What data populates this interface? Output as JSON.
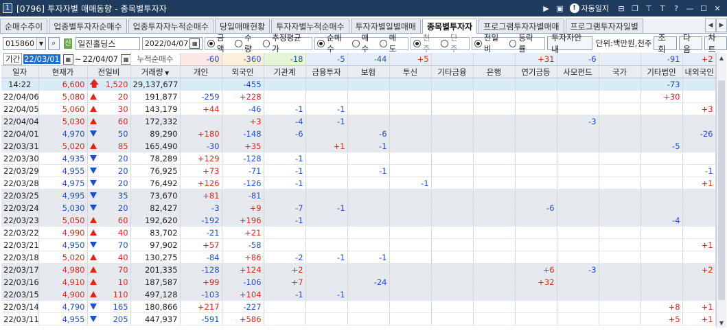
{
  "window": {
    "badge": "1",
    "title": "[0796] 투자자별 매매동향 - 종목별투자자",
    "auto_lock": "자동일지"
  },
  "tabs": [
    {
      "label": "순매수추이",
      "active": false
    },
    {
      "label": "업종별투자자순매수",
      "active": false
    },
    {
      "label": "업종투자자누적순매수",
      "active": false
    },
    {
      "label": "당일매매현황",
      "active": false
    },
    {
      "label": "투자자별누적순매수",
      "active": false
    },
    {
      "label": "투자자별일별매매",
      "active": false
    },
    {
      "label": "종목별투자자",
      "active": true
    },
    {
      "label": "프로그램투자자별매매",
      "active": false
    },
    {
      "label": "프로그램투자자일별",
      "active": false
    }
  ],
  "toolbar": {
    "code": "015860",
    "sin": "신",
    "stock_name": "일진홀딩스",
    "date": "2022/04/07",
    "radio_amount": [
      "금액",
      "수량",
      "추정평균가"
    ],
    "radio_trade": [
      "순매수",
      "매수",
      "매도"
    ],
    "radio_unit": [
      "천주",
      "단주"
    ],
    "radio_compare": [
      "전일비",
      "등락률"
    ],
    "guide_btn": "투자자안내",
    "unit_text": "단위:백만원,천주",
    "search_btn": "조회",
    "next_btn": "다음",
    "chart_btn": "차트"
  },
  "period": {
    "label": "기간",
    "from": "22/03/01",
    "to": "22/04/07",
    "cumulative": "누적순매수"
  },
  "summary": [
    "",
    "",
    "",
    "-60",
    "-360",
    "-18",
    "-5",
    "-44",
    "+5",
    "",
    "",
    "+31",
    "-6",
    "",
    "-91",
    "+2"
  ],
  "columns": [
    "일자",
    "현재가",
    "전일비",
    "거래량",
    "개인",
    "외국인",
    "기관계",
    "금융투자",
    "보험",
    "투신",
    "기타금융",
    "은행",
    "연기금등",
    "사모펀드",
    "국가",
    "기타법인",
    "내외국인"
  ],
  "rows": [
    {
      "date": "14:22",
      "price": "6,600",
      "dir": "upper",
      "chg": "1,520",
      "vol": "29,137,677",
      "v": [
        "",
        "-455",
        "",
        "",
        "",
        "",
        "",
        "",
        "",
        "",
        "",
        "-73",
        ""
      ],
      "now": true
    },
    {
      "date": "22/04/06",
      "price": "5,080",
      "dir": "up",
      "chg": "20",
      "vol": "191,877",
      "v": [
        "-259",
        "+228",
        "",
        "",
        "",
        "",
        "",
        "",
        "",
        "",
        "",
        "+30",
        ""
      ]
    },
    {
      "date": "22/04/05",
      "price": "5,060",
      "dir": "up",
      "chg": "30",
      "vol": "143,179",
      "v": [
        "+44",
        "-46",
        "-1",
        "-1",
        "",
        "",
        "",
        "",
        "",
        "",
        "",
        "",
        "+3"
      ]
    },
    {
      "date": "22/04/04",
      "price": "5,030",
      "dir": "up",
      "chg": "60",
      "vol": "172,332",
      "v": [
        "",
        "+3",
        "-4",
        "-1",
        "",
        "",
        "",
        "",
        "",
        "-3",
        "",
        "",
        ""
      ]
    },
    {
      "date": "22/04/01",
      "price": "4,970",
      "dir": "down",
      "chg": "50",
      "vol": "89,290",
      "v": [
        "+180",
        "-148",
        "-6",
        "",
        "-6",
        "",
        "",
        "",
        "",
        "",
        "",
        "",
        "-26"
      ]
    },
    {
      "date": "22/03/31",
      "price": "5,020",
      "dir": "up",
      "chg": "85",
      "vol": "165,490",
      "v": [
        "-30",
        "+35",
        "",
        "+1",
        "-1",
        "",
        "",
        "",
        "",
        "",
        "",
        "-5",
        ""
      ]
    },
    {
      "date": "22/03/30",
      "price": "4,935",
      "dir": "down",
      "chg": "20",
      "vol": "78,289",
      "v": [
        "+129",
        "-128",
        "-1",
        "",
        "",
        "",
        "",
        "",
        "",
        "",
        "",
        "",
        ""
      ]
    },
    {
      "date": "22/03/29",
      "price": "4,955",
      "dir": "down",
      "chg": "20",
      "vol": "76,925",
      "v": [
        "+73",
        "-71",
        "-1",
        "",
        "-1",
        "",
        "",
        "",
        "",
        "",
        "",
        "",
        "-1"
      ]
    },
    {
      "date": "22/03/28",
      "price": "4,975",
      "dir": "down",
      "chg": "20",
      "vol": "76,492",
      "v": [
        "+126",
        "-126",
        "-1",
        "",
        "",
        "-1",
        "",
        "",
        "",
        "",
        "",
        "",
        "+1"
      ]
    },
    {
      "date": "22/03/25",
      "price": "4,995",
      "dir": "down",
      "chg": "35",
      "vol": "73,670",
      "v": [
        "+81",
        "-81",
        "",
        "",
        "",
        "",
        "",
        "",
        "",
        "",
        "",
        "",
        ""
      ]
    },
    {
      "date": "22/03/24",
      "price": "5,030",
      "dir": "down",
      "chg": "20",
      "vol": "82,427",
      "v": [
        "-3",
        "+9",
        "-7",
        "-1",
        "",
        "",
        "",
        "",
        "-6",
        "",
        "",
        "",
        ""
      ]
    },
    {
      "date": "22/03/23",
      "price": "5,050",
      "dir": "up",
      "chg": "60",
      "vol": "192,620",
      "v": [
        "-192",
        "+196",
        "-1",
        "",
        "",
        "",
        "",
        "",
        "",
        "",
        "",
        "-4",
        ""
      ]
    },
    {
      "date": "22/03/22",
      "price": "4,990",
      "dir": "up",
      "chg": "40",
      "vol": "83,702",
      "v": [
        "-21",
        "+21",
        "",
        "",
        "",
        "",
        "",
        "",
        "",
        "",
        "",
        "",
        ""
      ]
    },
    {
      "date": "22/03/21",
      "price": "4,950",
      "dir": "down",
      "chg": "70",
      "vol": "97,902",
      "v": [
        "+57",
        "-58",
        "",
        "",
        "",
        "",
        "",
        "",
        "",
        "",
        "",
        "",
        "+1"
      ]
    },
    {
      "date": "22/03/18",
      "price": "5,020",
      "dir": "up",
      "chg": "40",
      "vol": "130,275",
      "v": [
        "-84",
        "+86",
        "-2",
        "-1",
        "-1",
        "",
        "",
        "",
        "",
        "",
        "",
        "",
        ""
      ]
    },
    {
      "date": "22/03/17",
      "price": "4,980",
      "dir": "up",
      "chg": "70",
      "vol": "201,335",
      "v": [
        "-128",
        "+124",
        "+2",
        "",
        "",
        "",
        "",
        "",
        "+6",
        "-3",
        "",
        "",
        "+2"
      ]
    },
    {
      "date": "22/03/16",
      "price": "4,910",
      "dir": "up",
      "chg": "10",
      "vol": "187,587",
      "v": [
        "+99",
        "-106",
        "+7",
        "",
        "-24",
        "",
        "",
        "",
        "+32",
        "",
        "",
        "",
        ""
      ]
    },
    {
      "date": "22/03/15",
      "price": "4,900",
      "dir": "up",
      "chg": "110",
      "vol": "497,128",
      "v": [
        "-103",
        "+104",
        "-1",
        "-1",
        "",
        "",
        "",
        "",
        "",
        "",
        "",
        "",
        ""
      ]
    },
    {
      "date": "22/03/14",
      "price": "4,790",
      "dir": "down",
      "chg": "165",
      "vol": "180,866",
      "v": [
        "+217",
        "-227",
        "",
        "",
        "",
        "",
        "",
        "",
        "",
        "",
        "",
        "+8",
        "+1"
      ]
    },
    {
      "date": "22/03/11",
      "price": "4,955",
      "dir": "down",
      "chg": "205",
      "vol": "447,937",
      "v": [
        "-591",
        "+586",
        "",
        "",
        "",
        "",
        "",
        "",
        "",
        "",
        "",
        "+5",
        "+1"
      ]
    }
  ],
  "colors": {
    "up": "#e0261b",
    "down": "#1c4fc7",
    "titlebar": "#1f3b5e"
  }
}
